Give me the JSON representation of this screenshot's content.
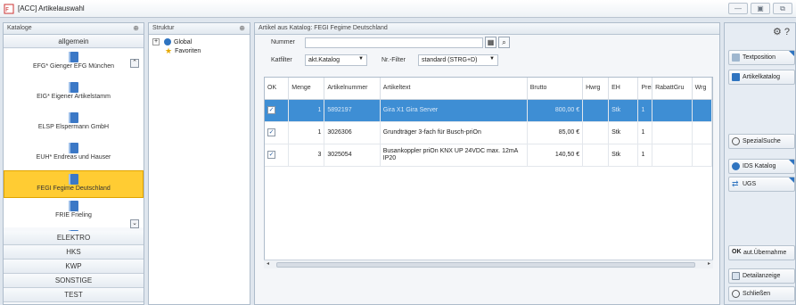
{
  "window": {
    "title": "[ACC] Artikelauswahl"
  },
  "kataloge": {
    "header": "Kataloge",
    "group_top": "allgemein",
    "items": [
      "EFG* Gienger EFG München",
      "EIG* Eigener Artikelstamm",
      "ELSP Elspermann GmbH",
      "EUH* Endreas und Hauser",
      "FEGI Fegime Deutschland",
      "FRIE Frieling",
      ""
    ],
    "selected": "FEGI Fegime Deutschland",
    "groups": [
      "ELEKTRO",
      "HKS",
      "KWP",
      "SONSTIGE",
      "TEST"
    ]
  },
  "struktur": {
    "header": "Struktur",
    "nodes": [
      "Global",
      "Favoriten"
    ]
  },
  "artikel": {
    "header": "Artikel aus Katalog: FEGI Fegime Deutschland",
    "nummer_label": "Nummer",
    "nummer_value": "",
    "katfilter_label": "Katfilter",
    "katfilter_value": "akt.Katalog",
    "nrfilter_label": "Nr.-Filter",
    "nrfilter_value": "standard (STRG+D)",
    "columns": [
      "OK",
      "Menge",
      "Artikelnummer",
      "Artikeltext",
      "Brutto",
      "Hwrg",
      "EH",
      "Prei",
      "RabattGru",
      "Wrg"
    ],
    "rows": [
      {
        "menge": "1",
        "nr": "5892197",
        "text": "Gira X1 Gira Server",
        "brutto": "800,00 €",
        "hwrg": "",
        "eh": "Stk",
        "prei": "1"
      },
      {
        "menge": "1",
        "nr": "3026306",
        "text": "Grundträger 3-fach für Busch-priOn",
        "brutto": "85,00 €",
        "hwrg": "",
        "eh": "Stk",
        "prei": "1"
      },
      {
        "menge": "3",
        "nr": "3025054",
        "text": "Busankoppler priOn KNX UP 24VDC max. 12mA IP20",
        "brutto": "140,50 €",
        "hwrg": "",
        "eh": "Stk",
        "prei": "1"
      }
    ]
  },
  "actions": {
    "textposition": "Textposition",
    "artikelkatalog": "Artikelkatalog",
    "spezialsuche": "SpezialSuche",
    "ids_katalog": "IDS Katalog",
    "ugs": "UGS",
    "uebernahme": "aut.Übernahme",
    "detailanzeige": "Detailanzeige",
    "schliessen": "Schließen"
  },
  "colors": {
    "selected_catalog": "#ffcc33",
    "selected_row": "#3e8ed4",
    "accent": "#2f74c0"
  }
}
